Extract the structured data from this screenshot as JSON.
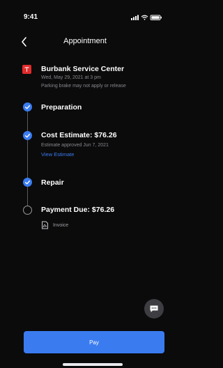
{
  "status_bar": {
    "time": "9:41"
  },
  "header": {
    "title": "Appointment"
  },
  "timeline": {
    "service_center": {
      "title": "Burbank Service Center",
      "datetime": "Wed, May 29, 2021 at 3 pm",
      "note": "Parking brake may not apply or release"
    },
    "preparation": {
      "title": "Preparation"
    },
    "cost_estimate": {
      "title": "Cost Estimate: $76.26",
      "status": "Estimate approved Jun 7, 2021",
      "link": "View Estimate"
    },
    "repair": {
      "title": "Repair"
    },
    "payment": {
      "title": "Payment Due: $76.26",
      "invoice_label": "Invoice"
    }
  },
  "actions": {
    "pay_label": "Pay"
  },
  "colors": {
    "background": "#0b0b0c",
    "accent": "#3a7cf0",
    "service_red": "#e12c2c",
    "muted_text": "#88888d"
  }
}
